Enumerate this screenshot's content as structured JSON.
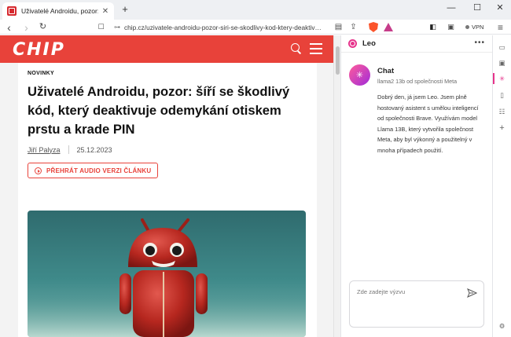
{
  "browser": {
    "tab": {
      "title": "Uživatelé Androidu, pozor: šíří se škodlivý kód",
      "close_glyph": "✕"
    },
    "newtab_glyph": "+",
    "window_controls": {
      "minimize": "—",
      "maximize": "☐",
      "close": "✕"
    },
    "toolbar": {
      "back": "‹",
      "forward": "›",
      "reload": "↻",
      "bookmark": "☐",
      "url": "chip.cz/uzivatele-androidu-pozor-siri-se-skodlivy-kod-ktery-deaktiv…",
      "share": "⇪",
      "reader": "▤",
      "vpn_label": "VPN",
      "menu": "≡"
    }
  },
  "site": {
    "logo": "CHIP",
    "brand_color": "#e8423a"
  },
  "article": {
    "category": "NOVINKY",
    "headline": "Uživatelé Androidu, pozor: šíří se škodlivý kód, který deaktivuje odemykání otiskem prstu a krade PIN",
    "author": "Jiří Palyza",
    "date": "25.12.2023",
    "audio_button": "PŘEHRÁT AUDIO VERZI ČLÁNKU"
  },
  "leo_panel": {
    "title": "Leo",
    "more_glyph": "•••",
    "chat_title": "Chat",
    "model_info": "llama2 13b od společnosti Meta",
    "message": "Dobrý den, já jsem Leo. Jsem plně hostovaný asistent s umělou inteligencí od společnosti Brave. Využívám model Llama 13B, který vytvořila společnost Meta, aby byl výkonný a použitelný v mnoha případech použití.",
    "input_placeholder": "Zde zadejte výzvu",
    "accent_color": "#e6338b"
  },
  "sidebar_rail": {
    "icons": [
      "video-icon",
      "wallet-icon",
      "leo-icon",
      "bookmarks-icon",
      "reading-list-icon",
      "add-icon",
      "settings-icon"
    ],
    "glyphs": {
      "video": "▭",
      "wallet": "▣",
      "leo": "✳",
      "bookmarks": "▯",
      "reading": "☷",
      "add": "+",
      "settings": "⚙"
    }
  }
}
